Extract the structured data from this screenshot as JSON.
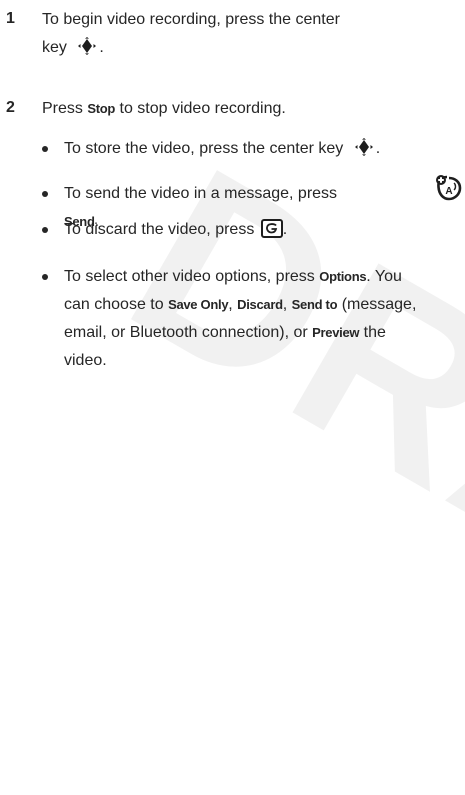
{
  "watermark": "DRAFT",
  "steps": [
    {
      "number": "1",
      "text_a": "To begin video recording, press the center",
      "text_b": "key"
    },
    {
      "number": "2",
      "text_a": "Press",
      "key": "Stop",
      "text_b": "to stop video recording."
    }
  ],
  "bullets": [
    {
      "text": "To store the video, press the center key"
    },
    {
      "text_a": "To send the video in a message, press",
      "key": "Send",
      "text_b": "."
    },
    {
      "text_a": "To discard the video, press",
      "text_b": "."
    },
    {
      "line1_a": "To select other video options, press",
      "key_options": "Options",
      "line1_b": ". You",
      "line2_a": "can choose to",
      "key_save": "Save Only",
      "comma1": ",",
      "key_discard": "Discard",
      "comma2": ",",
      "key_sendto": "Send to",
      "line2_b": "(message,",
      "line3_a": "email, or Bluetooth connection), or",
      "key_preview": "Preview",
      "line3_b": "the",
      "line4": "video."
    }
  ],
  "icons": {
    "nav_key": "center-navigation-key-icon",
    "end_key": "end-key-icon",
    "send_feature": "send-feature-icon"
  },
  "colors": {
    "text": "#262626",
    "watermark": "#f1f1f1"
  }
}
